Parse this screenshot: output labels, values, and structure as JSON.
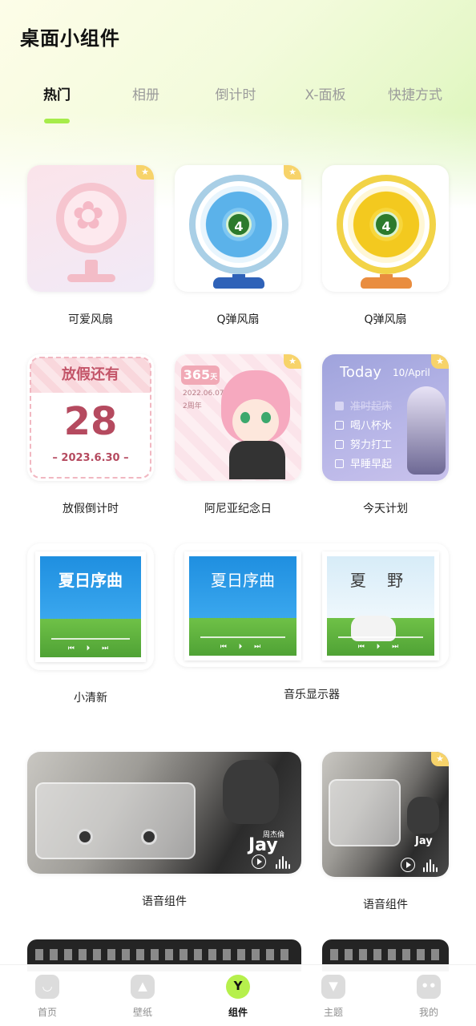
{
  "header": {
    "title": "桌面小组件"
  },
  "tabs": [
    {
      "label": "热门",
      "active": true
    },
    {
      "label": "相册"
    },
    {
      "label": "倒计时"
    },
    {
      "label": "X-面板"
    },
    {
      "label": "快捷方式"
    }
  ],
  "widgets": {
    "cute_fan": {
      "label": "可爱风扇"
    },
    "q_fan_blue": {
      "label": "Q弹风扇",
      "speed": "4"
    },
    "q_fan_yellow": {
      "label": "Q弹风扇",
      "speed": "4"
    },
    "vacation": {
      "label": "放假倒计时",
      "title": "放假还有",
      "days": "28",
      "date": "– 2023.6.30 –"
    },
    "anya": {
      "label": "阿尼亚纪念日",
      "days": "365",
      "unit": "天",
      "start_date": "2022.06.07",
      "anniversary": "2周年"
    },
    "today": {
      "label": "今天计划",
      "title": "Today",
      "date": "10/April",
      "items": [
        {
          "text": "准时起床",
          "done": true
        },
        {
          "text": "喝八杯水"
        },
        {
          "text": "努力打工"
        },
        {
          "text": "早睡早起"
        }
      ]
    },
    "fresh": {
      "label": "小清新",
      "album_title": "夏日序曲"
    },
    "music_display": {
      "label": "音乐显示器",
      "album1_title": "夏日序曲",
      "album2_title": "夏 野"
    },
    "voice_large": {
      "label": "语音组件",
      "cover_text": "Jay",
      "artist": "周杰倫"
    },
    "voice_small": {
      "label": "语音组件",
      "cover_text": "Jay"
    }
  },
  "bottom_nav": [
    {
      "label": "首页",
      "icon": "home-icon"
    },
    {
      "label": "壁纸",
      "icon": "wallpaper-icon"
    },
    {
      "label": "组件",
      "icon": "widget-icon",
      "active": true,
      "glyph": "Y"
    },
    {
      "label": "主题",
      "icon": "theme-icon"
    },
    {
      "label": "我的",
      "icon": "profile-icon"
    }
  ],
  "colors": {
    "accent": "#a6ec4a",
    "nav_active": "#b6f04c"
  }
}
